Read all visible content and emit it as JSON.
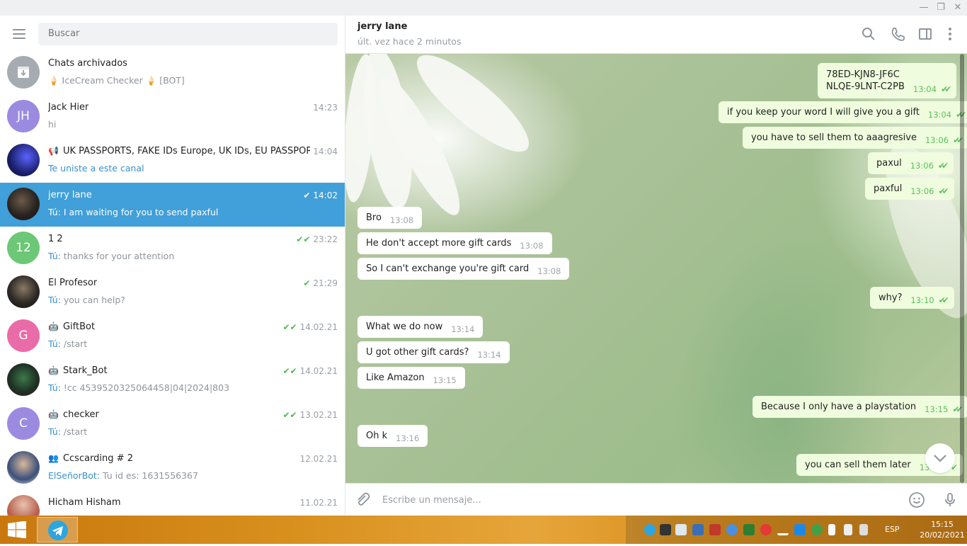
{
  "window": {
    "minimize": "—",
    "restore": "❐",
    "close": "✕"
  },
  "sidebar": {
    "search_placeholder": "Buscar",
    "chats": [
      {
        "name": "Chats archivados",
        "preview": "🍦 IceCream Checker 🍦 [BOT]",
        "time": ""
      },
      {
        "name": "Jack Hier",
        "initials": "JH",
        "preview": "hi",
        "time": "14:23"
      },
      {
        "name": "UK PASSPORTS, FAKE IDs Europe, UK IDs, EU PASSPORT...",
        "preview": "Te uniste a este canal",
        "time": "14:04"
      },
      {
        "name": "jerry lane",
        "you": "Tú:",
        "preview": "I am waiting for you to send paxful",
        "time": "14:02"
      },
      {
        "name": "1 2",
        "initials": "12",
        "you": "Tú:",
        "preview": "thanks for your attention",
        "time": "23:22"
      },
      {
        "name": "El Profesor",
        "you": "Tú:",
        "preview": "you can help?",
        "time": "21:29"
      },
      {
        "name": "GiftBot",
        "initials": "G",
        "you": "Tú:",
        "preview": "/start",
        "time": "14.02.21"
      },
      {
        "name": "Stark_Bot",
        "you": "Tú:",
        "preview": "!cc 4539520325064458|04|2024|803",
        "time": "14.02.21"
      },
      {
        "name": "checker",
        "initials": "C",
        "you": "Tú:",
        "preview": "/start",
        "time": "13.02.21"
      },
      {
        "name": "Ccscarding # 2",
        "you": "ElSeñorBot:",
        "preview": "Tu id es: 1631556367",
        "time": "12.02.21"
      },
      {
        "name": "Hicham Hisham",
        "preview": "",
        "time": "11.02.21"
      }
    ]
  },
  "chat": {
    "peer_name": "jerry lane",
    "peer_status": "últ. vez hace 2 minutos",
    "messages": [
      {
        "dir": "out",
        "text1": "78ED-KJN8-JF6C",
        "text": "NLQE-9LNT-C2PB",
        "time": "13:04"
      },
      {
        "dir": "out",
        "text": "if you keep your word I will give you a gift",
        "time": "13:04"
      },
      {
        "dir": "out",
        "text": "you have to sell them to aaagresive",
        "time": "13:06"
      },
      {
        "dir": "out",
        "text": "paxul",
        "time": "13:06"
      },
      {
        "dir": "out",
        "text": "paxful",
        "time": "13:06"
      },
      {
        "dir": "in",
        "text": "Bro",
        "time": "13:08"
      },
      {
        "dir": "in",
        "text": "He don't accept more gift cards",
        "time": "13:08"
      },
      {
        "dir": "in",
        "text": "So I can't exchange you're gift card",
        "time": "13:08"
      },
      {
        "dir": "out",
        "text": "why?",
        "time": "13:10"
      },
      {
        "dir": "in",
        "text": "What we do now",
        "time": "13:14"
      },
      {
        "dir": "in",
        "text": "U got other gift cards?",
        "time": "13:14"
      },
      {
        "dir": "in",
        "text": "Like Amazon",
        "time": "13:15"
      },
      {
        "dir": "out",
        "text": "Because I only have a playstation",
        "time": "13:15"
      },
      {
        "dir": "in",
        "text": "Oh k",
        "time": "13:16"
      },
      {
        "dir": "out",
        "text": "you can sell them later",
        "time": "13:16"
      }
    ],
    "composer_placeholder": "Escribe un mensaje..."
  },
  "taskbar": {
    "lang": "ESP",
    "time": "15:15",
    "date": "20/02/2021"
  },
  "colors": {
    "accent": "#419fd9",
    "out_bubble": "#effdde",
    "check": "#4dbc4d"
  }
}
